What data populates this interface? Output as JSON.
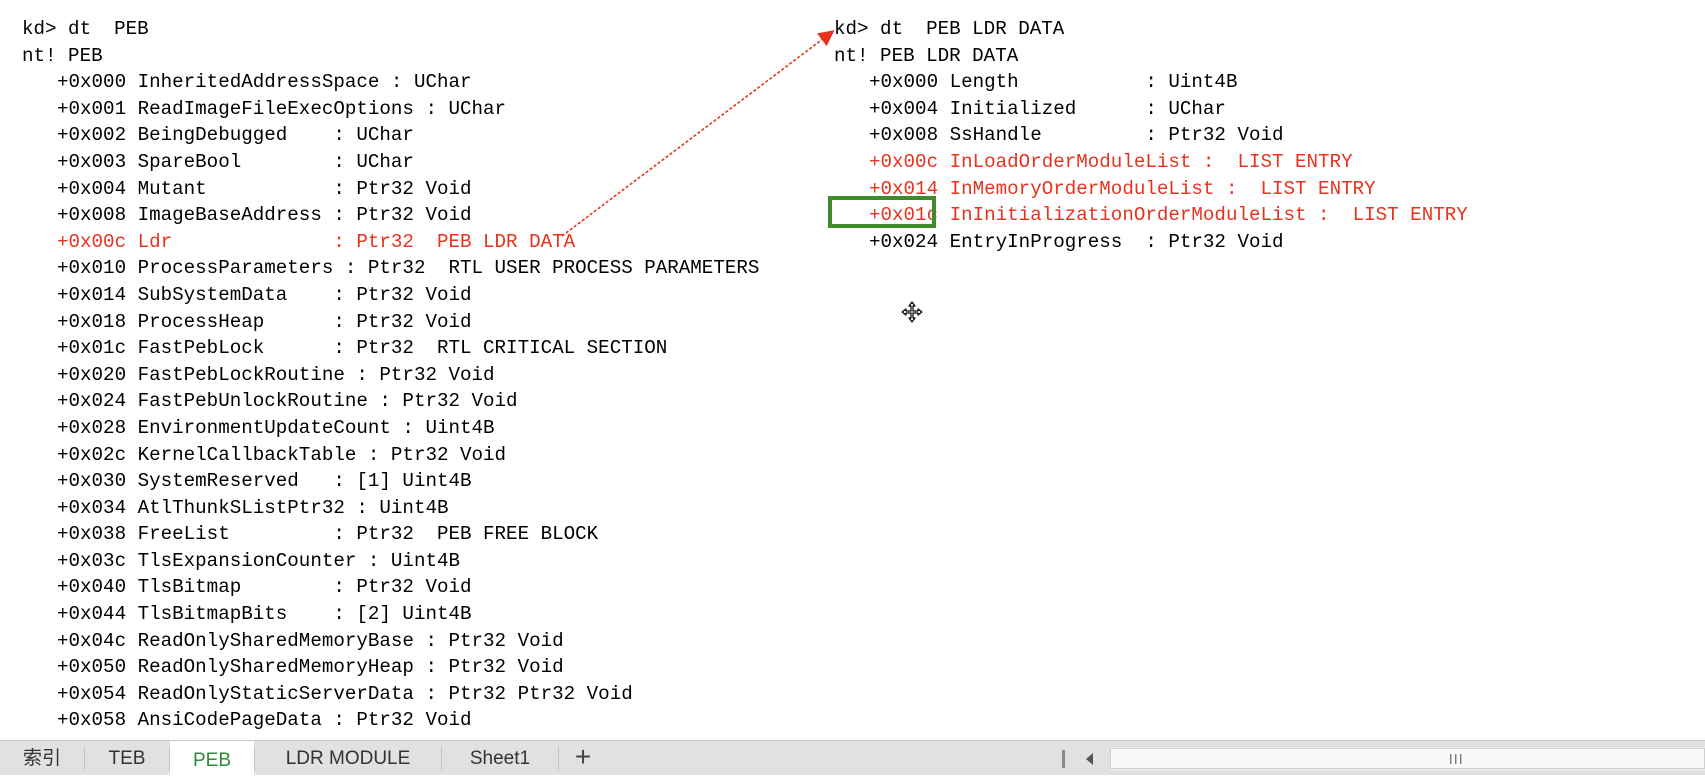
{
  "left_panel": {
    "lines": [
      {
        "text": "kd> dt  PEB",
        "indent": 0,
        "highlight": false
      },
      {
        "text": "nt! PEB",
        "indent": 0,
        "highlight": false
      },
      {
        "text": "+0x000 InheritedAddressSpace : UChar",
        "indent": 1,
        "highlight": false
      },
      {
        "text": "+0x001 ReadImageFileExecOptions : UChar",
        "indent": 1,
        "highlight": false
      },
      {
        "text": "+0x002 BeingDebugged    : UChar",
        "indent": 1,
        "highlight": false
      },
      {
        "text": "+0x003 SpareBool        : UChar",
        "indent": 1,
        "highlight": false
      },
      {
        "text": "+0x004 Mutant           : Ptr32 Void",
        "indent": 1,
        "highlight": false
      },
      {
        "text": "+0x008 ImageBaseAddress : Ptr32 Void",
        "indent": 1,
        "highlight": false
      },
      {
        "text": "+0x00c Ldr              : Ptr32  PEB LDR DATA",
        "indent": 1,
        "highlight": true
      },
      {
        "text": "+0x010 ProcessParameters : Ptr32  RTL USER PROCESS PARAMETERS",
        "indent": 1,
        "highlight": false
      },
      {
        "text": "+0x014 SubSystemData    : Ptr32 Void",
        "indent": 1,
        "highlight": false
      },
      {
        "text": "+0x018 ProcessHeap      : Ptr32 Void",
        "indent": 1,
        "highlight": false
      },
      {
        "text": "+0x01c FastPebLock      : Ptr32  RTL CRITICAL SECTION",
        "indent": 1,
        "highlight": false
      },
      {
        "text": "+0x020 FastPebLockRoutine : Ptr32 Void",
        "indent": 1,
        "highlight": false
      },
      {
        "text": "+0x024 FastPebUnlockRoutine : Ptr32 Void",
        "indent": 1,
        "highlight": false
      },
      {
        "text": "+0x028 EnvironmentUpdateCount : Uint4B",
        "indent": 1,
        "highlight": false
      },
      {
        "text": "+0x02c KernelCallbackTable : Ptr32 Void",
        "indent": 1,
        "highlight": false
      },
      {
        "text": "+0x030 SystemReserved   : [1] Uint4B",
        "indent": 1,
        "highlight": false
      },
      {
        "text": "+0x034 AtlThunkSListPtr32 : Uint4B",
        "indent": 1,
        "highlight": false
      },
      {
        "text": "+0x038 FreeList         : Ptr32  PEB FREE BLOCK",
        "indent": 1,
        "highlight": false
      },
      {
        "text": "+0x03c TlsExpansionCounter : Uint4B",
        "indent": 1,
        "highlight": false
      },
      {
        "text": "+0x040 TlsBitmap        : Ptr32 Void",
        "indent": 1,
        "highlight": false
      },
      {
        "text": "+0x044 TlsBitmapBits    : [2] Uint4B",
        "indent": 1,
        "highlight": false
      },
      {
        "text": "+0x04c ReadOnlySharedMemoryBase : Ptr32 Void",
        "indent": 1,
        "highlight": false
      },
      {
        "text": "+0x050 ReadOnlySharedMemoryHeap : Ptr32 Void",
        "indent": 1,
        "highlight": false
      },
      {
        "text": "+0x054 ReadOnlyStaticServerData : Ptr32 Ptr32 Void",
        "indent": 1,
        "highlight": false
      },
      {
        "text": "+0x058 AnsiCodePageData : Ptr32 Void",
        "indent": 1,
        "highlight": false
      }
    ]
  },
  "right_panel": {
    "lines": [
      {
        "text": "kd> dt  PEB LDR DATA",
        "indent": 0,
        "highlight": false
      },
      {
        "text": "nt! PEB LDR DATA",
        "indent": 0,
        "highlight": false
      },
      {
        "text": "+0x000 Length           : Uint4B",
        "indent": 1,
        "highlight": false
      },
      {
        "text": "+0x004 Initialized      : UChar",
        "indent": 1,
        "highlight": false
      },
      {
        "text": "+0x008 SsHandle         : Ptr32 Void",
        "indent": 1,
        "highlight": false
      },
      {
        "text": "+0x00c InLoadOrderModuleList :  LIST ENTRY",
        "indent": 1,
        "highlight": true
      },
      {
        "text": "+0x014 InMemoryOrderModuleList :  LIST ENTRY",
        "indent": 1,
        "highlight": true
      },
      {
        "text": "+0x01c InInitializationOrderModuleList :  LIST ENTRY",
        "indent": 1,
        "highlight": true
      },
      {
        "text": "+0x024 EntryInProgress  : Ptr32 Void",
        "indent": 1,
        "highlight": false
      }
    ]
  },
  "annotations": {
    "arrow_color": "#e8321e",
    "box_color": "#3f8a2a",
    "cursor_icon": "move-cursor-icon"
  },
  "sheet_tabs": {
    "tabs": [
      {
        "label": "索引",
        "active": false
      },
      {
        "label": "TEB",
        "active": false
      },
      {
        "label": "PEB",
        "active": true
      },
      {
        "label": " LDR MODULE",
        "active": false
      },
      {
        "label": "Sheet1",
        "active": false
      }
    ],
    "add_label": "+",
    "active_color": "#2e8b3a"
  },
  "scrollbar": {
    "left_arrow_icon": "scroll-left-icon",
    "grip_icon": "scroll-grip-icon"
  }
}
